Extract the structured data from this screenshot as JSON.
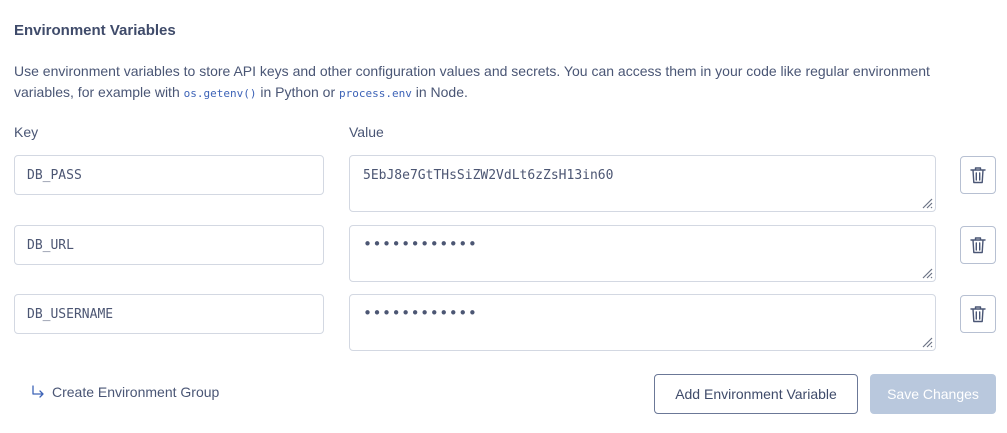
{
  "section": {
    "title": "Environment Variables",
    "description_part1": "Use environment variables to store API keys and other configuration values and secrets. You can access them in your code like regular environment variables, for example with ",
    "code1": "os.getenv()",
    "description_part2": " in Python or ",
    "code2": "process.env",
    "description_part3": " in Node."
  },
  "columns": {
    "key_label": "Key",
    "value_label": "Value"
  },
  "variables": [
    {
      "key": "DB_PASS",
      "value": "5EbJ8e7GtTHsSiZW2VdLt6zZsH13in60",
      "masked": false
    },
    {
      "key": "DB_URL",
      "value": "••••••••••••",
      "masked": true
    },
    {
      "key": "DB_USERNAME",
      "value": "••••••••••••",
      "masked": true
    }
  ],
  "actions": {
    "create_group_label": "Create Environment Group",
    "add_variable_label": "Add Environment Variable",
    "save_label": "Save Changes"
  },
  "icons": {
    "delete": "trash-icon",
    "create_group": "corner-down-right-arrow-icon",
    "resize": "resize-grip-icon"
  },
  "colors": {
    "text": "#3e4a67",
    "code": "#3d63b7",
    "save_disabled_bg": "#b9c8dd",
    "border": "#d3d8e2"
  }
}
